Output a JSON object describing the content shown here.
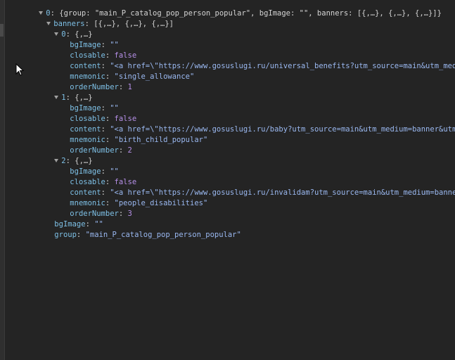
{
  "tree": {
    "root": {
      "index": "0",
      "preview": "{group: \"main_P_catalog_pop_person_popular\", bgImage: \"\", banners: [{,…}, {,…}, {,…}]}"
    },
    "banners": {
      "key": "banners",
      "preview": "[{,…}, {,…}, {,…}]",
      "items": [
        {
          "index": "0",
          "preview": "{,…}",
          "bgImage": "\"\"",
          "closable": "false",
          "content": "\"<a href=\\\"https://www.gosuslugi.ru/universal_benefits?utm_source=main&utm_medium=ba",
          "mnemonic": "\"single_allowance\"",
          "orderNumber": "1"
        },
        {
          "index": "1",
          "preview": "{,…}",
          "bgImage": "\"\"",
          "closable": "false",
          "content": "\"<a href=\\\"https://www.gosuslugi.ru/baby?utm_source=main&utm_medium=banner&utm_term=",
          "mnemonic": "\"birth_child_popular\"",
          "orderNumber": "2"
        },
        {
          "index": "2",
          "preview": "{,…}",
          "bgImage": "\"\"",
          "closable": "false",
          "content": "\"<a href=\\\"https://www.gosuslugi.ru/invalidam?utm_source=main&utm_medium=banner&utm_",
          "mnemonic": "\"people_disabilities\"",
          "orderNumber": "3"
        }
      ]
    },
    "bgImage": {
      "key": "bgImage",
      "value": "\"\""
    },
    "group": {
      "key": "group",
      "value": "\"main_P_catalog_pop_person_popular\""
    }
  },
  "labels": {
    "bgImage": "bgImage",
    "closable": "closable",
    "content": "content",
    "mnemonic": "mnemonic",
    "orderNumber": "orderNumber",
    "colon": ":"
  },
  "colors": {
    "background": "#242424",
    "key": "#7ec0e6",
    "string": "#9ab8f0",
    "keyword": "#b690e8"
  },
  "icons": {
    "expand": "triangle-down-icon",
    "cursor": "mouse-pointer-icon"
  }
}
